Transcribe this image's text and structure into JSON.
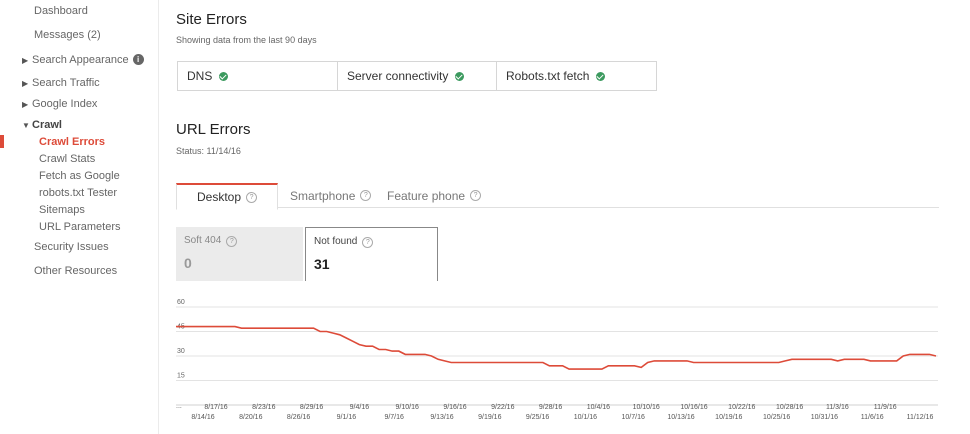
{
  "sidebar": {
    "dashboard": "Dashboard",
    "messages": "Messages (2)",
    "search_appearance": "Search Appearance",
    "search_traffic": "Search Traffic",
    "google_index": "Google Index",
    "crawl": "Crawl",
    "crawl_errors": "Crawl Errors",
    "crawl_stats": "Crawl Stats",
    "fetch_as_google": "Fetch as Google",
    "robots_tester": "robots.txt Tester",
    "sitemaps": "Sitemaps",
    "url_parameters": "URL Parameters",
    "security_issues": "Security Issues",
    "other_resources": "Other Resources"
  },
  "site_errors": {
    "title": "Site Errors",
    "subtitle": "Showing data from the last 90 days",
    "items": [
      {
        "label": "DNS",
        "status": "ok"
      },
      {
        "label": "Server connectivity",
        "status": "ok"
      },
      {
        "label": "Robots.txt fetch",
        "status": "ok"
      }
    ]
  },
  "url_errors": {
    "title": "URL Errors",
    "status": "Status: 11/14/16",
    "tabs": [
      "Desktop",
      "Smartphone",
      "Feature phone"
    ],
    "active_tab": "Desktop",
    "metrics": [
      {
        "label": "Soft 404",
        "value": "0"
      },
      {
        "label": "Not found",
        "value": "31"
      }
    ]
  },
  "colors": {
    "accent": "#dd4b39",
    "line": "#dd4b39",
    "ok": "#3c9a5f"
  },
  "chart_data": {
    "type": "line",
    "ylim": [
      0,
      60
    ],
    "yticks": [
      15,
      30,
      45,
      60
    ],
    "grid": true,
    "x_top": [
      "8/17/16",
      "8/23/16",
      "8/29/16",
      "9/4/16",
      "9/10/16",
      "9/16/16",
      "9/22/16",
      "9/28/16",
      "10/4/16",
      "10/10/16",
      "10/16/16",
      "10/22/16",
      "10/28/16",
      "11/3/16",
      "11/9/16"
    ],
    "x_bottom": [
      "8/14/16",
      "8/20/16",
      "8/26/16",
      "9/1/16",
      "9/7/16",
      "9/13/16",
      "9/19/16",
      "9/25/16",
      "10/1/16",
      "10/7/16",
      "10/13/16",
      "10/19/16",
      "10/25/16",
      "10/31/16",
      "11/6/16",
      "11/12/16"
    ],
    "x_ellipsis": "...",
    "series": [
      {
        "values": [
          48,
          48,
          48,
          48,
          48,
          48,
          48,
          48,
          48,
          48,
          47,
          47,
          47,
          47,
          47,
          47,
          47,
          47,
          47,
          47,
          47,
          47,
          45,
          45,
          44,
          43,
          41,
          39,
          37,
          36,
          36,
          34,
          34,
          33,
          33,
          31,
          31,
          31,
          31,
          30,
          28,
          27,
          26,
          26,
          26,
          26,
          26,
          26,
          26,
          26,
          26,
          26,
          26,
          26,
          26,
          26,
          26,
          24,
          24,
          24,
          22,
          22,
          22,
          22,
          22,
          22,
          24,
          24,
          24,
          24,
          24,
          23,
          26,
          27,
          27,
          27,
          27,
          27,
          27,
          26,
          26,
          26,
          26,
          26,
          26,
          26,
          26,
          26,
          26,
          26,
          26,
          26,
          26,
          27,
          28,
          28,
          28,
          28,
          28,
          28,
          28,
          27,
          28,
          28,
          28,
          28,
          27,
          27,
          27,
          27,
          27,
          30,
          31,
          31,
          31,
          31,
          30
        ]
      }
    ]
  }
}
